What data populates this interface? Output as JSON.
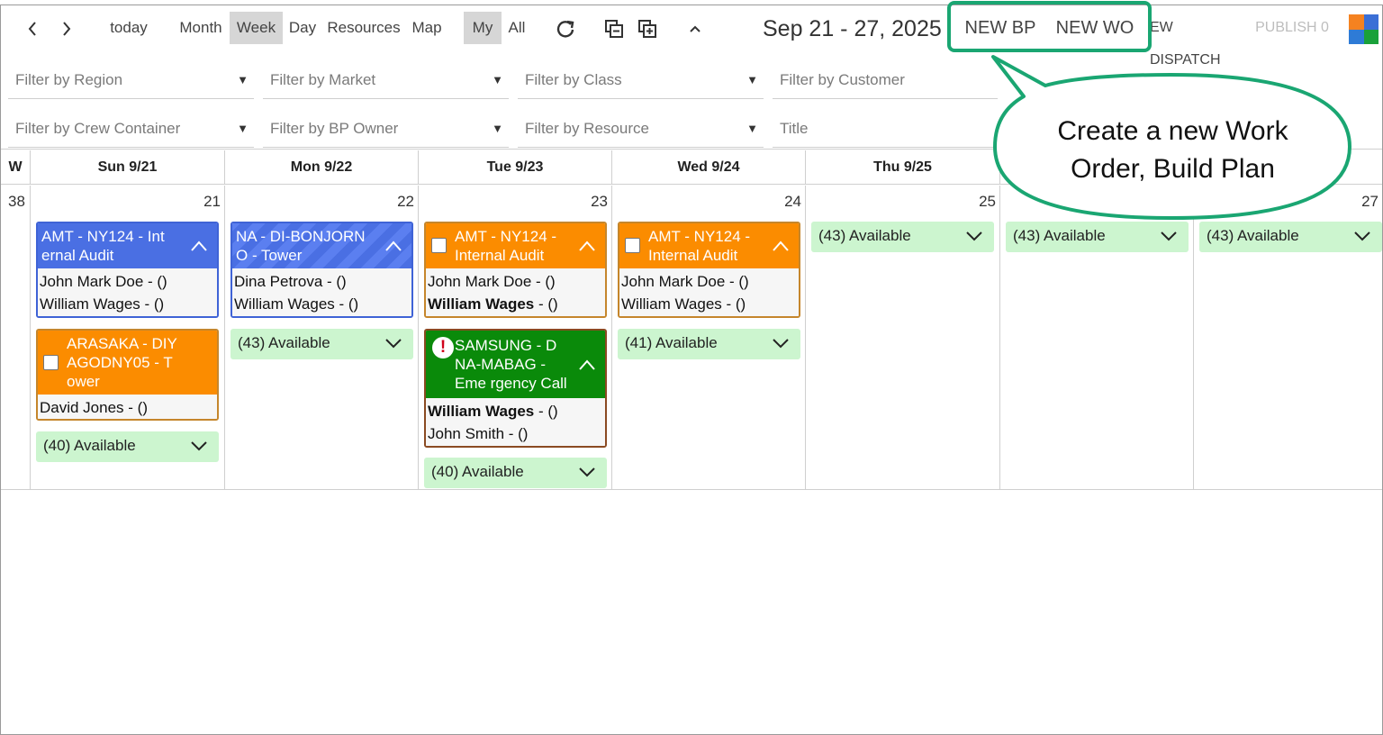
{
  "toolbar": {
    "prev": "‹",
    "next": "›",
    "today": "today",
    "views": {
      "month": "Month",
      "week": "Week",
      "day": "Day",
      "resources": "Resources",
      "map": "Map"
    },
    "active_view": "Week",
    "scope": {
      "my": "My",
      "all": "All"
    },
    "active_scope": "My",
    "date_range": "Sep 21 - 27, 2025",
    "new_bp": "NEW BP",
    "new_wo": "NEW WO",
    "new_dispatch": "EW DISPATCH",
    "publish": "PUBLISH 0"
  },
  "filters": [
    "Filter by Region",
    "Filter by Market",
    "Filter by Class",
    "Filter by Customer",
    "Filter by Crew Container",
    "Filter by BP Owner",
    "Filter by Resource",
    "Title"
  ],
  "calendar": {
    "week_col_label": "W",
    "week_number": "38",
    "days": [
      {
        "header": "Sun 9/21",
        "date": "21"
      },
      {
        "header": "Mon 9/22",
        "date": "22"
      },
      {
        "header": "Tue 9/23",
        "date": "23"
      },
      {
        "header": "Wed 9/24",
        "date": "24"
      },
      {
        "header": "Thu 9/25",
        "date": "25"
      },
      {
        "header": "",
        "date": ""
      },
      {
        "header": "",
        "date": "27"
      }
    ],
    "events": {
      "sun_1": {
        "title": "AMT - NY124 - Int ernal Audit",
        "people": [
          "John Mark Doe - ()",
          "William Wages - ()"
        ]
      },
      "sun_2": {
        "title": "ARASAKA - DIY AGODNY05 - T ower",
        "people": [
          "David Jones - ()"
        ]
      },
      "mon_1": {
        "title": "NA - DI-BONJORN O - Tower",
        "people": [
          "Dina Petrova - ()",
          "William Wages - ()"
        ]
      },
      "tue_1": {
        "title": "AMT - NY124 - Internal Audit",
        "people_bold": "William Wages",
        "people": [
          "John Mark Doe - ()",
          " - ()"
        ]
      },
      "tue_2": {
        "title": "SAMSUNG - D NA-MABAG - Eme rgency Call",
        "people_bold": "William Wages",
        "people": [
          " - ()",
          "John Smith - ()"
        ]
      },
      "wed_1": {
        "title": "AMT - NY124 - Internal Audit",
        "people": [
          "John Mark Doe - ()",
          "William Wages - ()"
        ]
      }
    },
    "available": {
      "sun": "(40) Available",
      "mon": "(43) Available",
      "tue": "(40) Available",
      "wed": "(41) Available",
      "thu": "(43) Available",
      "fri": "(43) Available",
      "sat": "(43) Available"
    }
  },
  "callout": {
    "line1": "Create a new Work",
    "line2": "Order, Build Plan"
  },
  "colors": {
    "highlight": "#1aa672",
    "blue_event": "#4a6fe3",
    "orange_event": "#fb8c00",
    "green_event": "#0a8a0a",
    "available_bg": "#ccf5cf"
  }
}
